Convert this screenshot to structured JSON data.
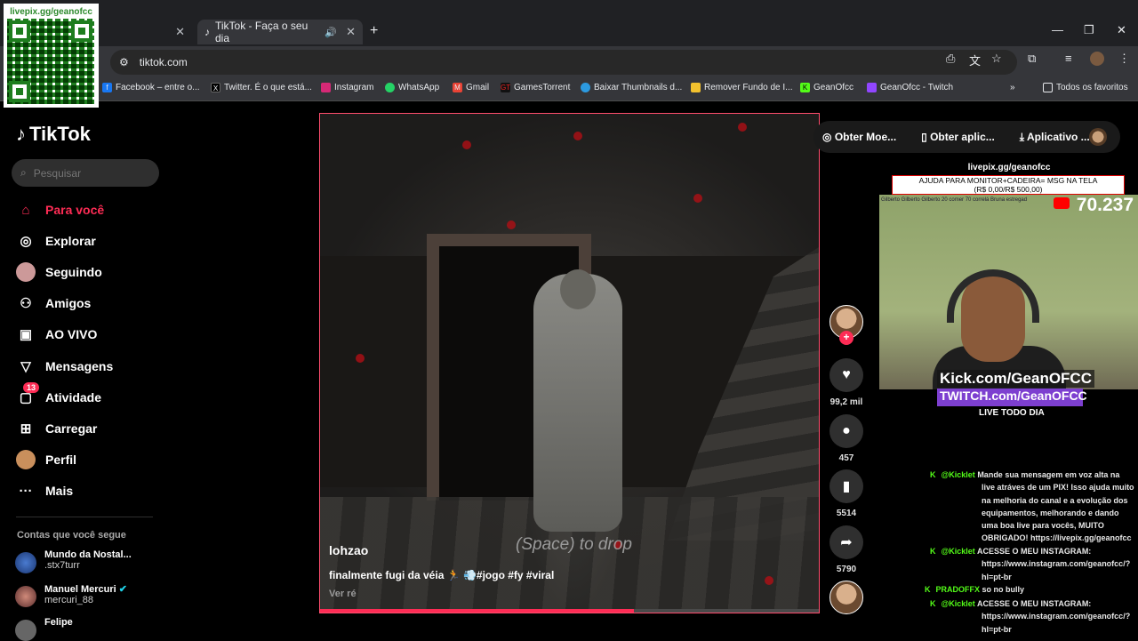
{
  "browser": {
    "tabs": [
      {
        "title": ""
      },
      {
        "title": "TikTok - Faça o seu dia"
      }
    ],
    "address": "tiktok.com",
    "bookmarks": [
      "Facebook – entre o...",
      "Twitter. É o que está...",
      "Instagram",
      "WhatsApp",
      "Gmail",
      "GamesTorrent",
      "Baixar Thumbnails d...",
      "Remover Fundo de I...",
      "GeanOfcc",
      "GeanOfcc - Twitch"
    ],
    "all_bookmarks": "Todos os favoritos"
  },
  "qr": {
    "label": "livepix.gg/geanofcc"
  },
  "tiktok": {
    "logo": "TikTok",
    "search_placeholder": "Pesquisar",
    "nav": [
      "Para você",
      "Explorar",
      "Seguindo",
      "Amigos",
      "AO VIVO",
      "Mensagens",
      "Atividade",
      "Carregar",
      "Perfil",
      "Mais"
    ],
    "activity_badge": "13",
    "following_title": "Contas que você segue",
    "accounts": [
      {
        "name": "Mundo da Nostal...",
        "handle": ".stx7turr"
      },
      {
        "name": "Manuel Mercuri",
        "handle": "mercuri_88"
      },
      {
        "name": "Felipe",
        "handle": ""
      }
    ],
    "topbar": [
      "Obter Moe...",
      "Obter aplic...",
      "Aplicativo ..."
    ],
    "video": {
      "author": "lohzao",
      "description": "finalmente fugi da véia 🏃 💨#jogo #fy #viral",
      "more": "Ver ré",
      "ingame_text": "(Space) to drop",
      "progress": 0.63
    },
    "actions": {
      "likes": "99,2 mil",
      "comments": "457",
      "saves": "5514",
      "shares": "5790"
    }
  },
  "overlay": {
    "pix": "livepix.gg/geanofcc",
    "goal_line1": "AJUDA PARA MONITOR+CADEIRA= MSG NA TELA",
    "goal_line2": "(R$ 0,00/R$ 500,00)",
    "cam_names": "Gilberto   Gilberto   Gilberto   20 comer 70 correlá   Bruna estregad",
    "count": "70.237",
    "kick": "Kick.com/GeanOFCC",
    "twitch": "TWITCH.com/GeanOFCC",
    "live": "LIVE TODO DIA"
  },
  "chat": [
    {
      "user": "@Kicklet",
      "text": "Mande sua mensagem em voz alta na live atráves de um PIX! Isso ajuda muito na melhoria do canal e a evolução dos equipamentos, melhorando e dando uma boa live para vocês, MUITO OBRIGADO! https://livepix.gg/geanofcc"
    },
    {
      "user": "@Kicklet",
      "text": "ACESSE O MEU INSTAGRAM: https://www.instagram.com/geanofcc/?hl=pt-br"
    },
    {
      "user": "PRADOFFX",
      "text": "so no bully"
    },
    {
      "user": "@Kicklet",
      "text": "ACESSE O MEU INSTAGRAM: https://www.instagram.com/geanofcc/?hl=pt-br"
    }
  ]
}
